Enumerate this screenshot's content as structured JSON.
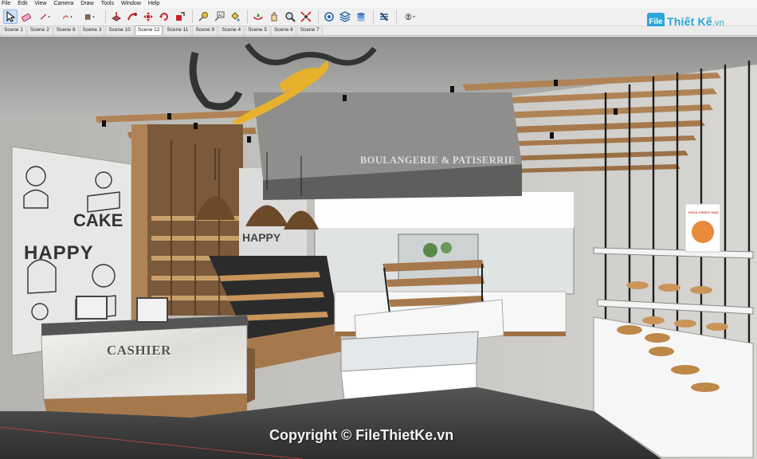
{
  "menu": [
    "File",
    "Edit",
    "View",
    "Camera",
    "Draw",
    "Tools",
    "Window",
    "Help"
  ],
  "toolbar": {
    "tools": [
      {
        "name": "select-tool-icon",
        "active": true
      },
      {
        "name": "eraser-tool-icon"
      },
      {
        "name": "line-tool-icon",
        "dropdown": true
      },
      {
        "name": "arc-tool-icon",
        "dropdown": true
      },
      {
        "name": "rectangle-tool-icon",
        "dropdown": true
      },
      {
        "name": "push-pull-tool-icon"
      },
      {
        "name": "follow-me-tool-icon"
      },
      {
        "name": "move-tool-icon"
      },
      {
        "name": "rotate-tool-icon"
      },
      {
        "name": "scale-tool-icon"
      },
      {
        "name": "tape-measure-tool-icon"
      },
      {
        "name": "text-tool-icon"
      },
      {
        "name": "paint-bucket-tool-icon"
      },
      {
        "name": "orbit-tool-icon"
      },
      {
        "name": "pan-tool-icon"
      },
      {
        "name": "zoom-tool-icon"
      },
      {
        "name": "zoom-extents-tool-icon"
      },
      {
        "name": "warehouse-icon"
      },
      {
        "name": "extension-warehouse-icon"
      },
      {
        "name": "layers-icon"
      },
      {
        "name": "styles-icon"
      },
      {
        "name": "account-icon",
        "dropdown": true
      }
    ]
  },
  "scenes": [
    {
      "label": "Scene 1"
    },
    {
      "label": "Scene 2"
    },
    {
      "label": "Scene 8"
    },
    {
      "label": "Scene 3"
    },
    {
      "label": "Scene 10"
    },
    {
      "label": "Scene 12",
      "active": true
    },
    {
      "label": "Scene 11"
    },
    {
      "label": "Scene 9"
    },
    {
      "label": "Scene 4"
    },
    {
      "label": "Scene 5"
    },
    {
      "label": "Scene 6"
    },
    {
      "label": "Scene 7"
    }
  ],
  "logo": {
    "icon_text": "File",
    "brand": "Thiết Kế",
    "domain": ".vn"
  },
  "viewport": {
    "sign_text": "BOULANGERIE & PATISERRIE",
    "cashier_text": "CASHIER",
    "mural_cake": "CAKE",
    "mural_happy": "HAPPY",
    "mural_happy_small": "HAPPY",
    "poster_text": "PIZZA CRISPY HAM",
    "copyright": "Copyright © FileThietKe.vn"
  },
  "colors": {
    "wood": "#b08356",
    "wood_dark": "#7a5a3a",
    "concrete": "#a9a9a7",
    "steel": "#2b2b2b",
    "marble": "#ecebe8",
    "logo_gold": "#e8b12c",
    "brand_blue": "#2aa5d8"
  }
}
